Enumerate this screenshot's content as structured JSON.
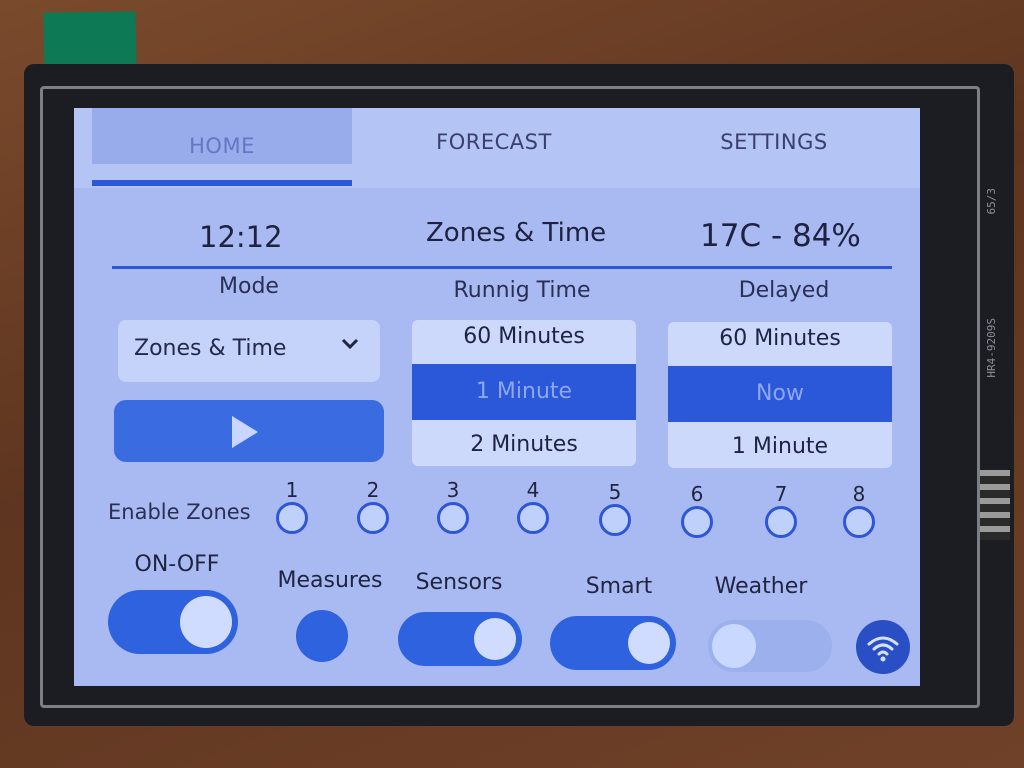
{
  "tabs": [
    {
      "label": "HOME",
      "active": true
    },
    {
      "label": "FORECAST",
      "active": false
    },
    {
      "label": "SETTINGS",
      "active": false
    }
  ],
  "status": {
    "time": "12:12",
    "title": "Zones & Time",
    "temp_humidity": "17C - 84%"
  },
  "mode": {
    "label": "Mode",
    "selected": "Zones & Time"
  },
  "running_time": {
    "label": "Runnig Time",
    "items": [
      "60 Minutes",
      "1 Minute",
      "2 Minutes"
    ],
    "selected_index": 1
  },
  "delayed": {
    "label": "Delayed",
    "items": [
      "60 Minutes",
      "Now",
      "1 Minute"
    ],
    "selected_index": 1
  },
  "zones": {
    "label": "Enable Zones",
    "items": [
      {
        "num": "1",
        "enabled": false
      },
      {
        "num": "2",
        "enabled": false
      },
      {
        "num": "3",
        "enabled": false
      },
      {
        "num": "4",
        "enabled": false
      },
      {
        "num": "5",
        "enabled": false
      },
      {
        "num": "6",
        "enabled": false
      },
      {
        "num": "7",
        "enabled": false
      },
      {
        "num": "8",
        "enabled": false
      }
    ]
  },
  "toggles": {
    "on_off": {
      "label": "ON-OFF",
      "on": true
    },
    "measures": {
      "label": "Measures"
    },
    "sensors": {
      "label": "Sensors",
      "on": true
    },
    "smart": {
      "label": "Smart",
      "on": true
    },
    "weather": {
      "label": "Weather",
      "on": false
    }
  },
  "pcb": {
    "text1": "HR4-9209S",
    "text2": "65/3"
  },
  "colors": {
    "accent": "#2e56d6",
    "screen_bg": "#a9b9f2"
  },
  "icons": {
    "play": "play-icon",
    "dropdown": "chevron-down-icon",
    "wifi": "wifi-icon"
  }
}
